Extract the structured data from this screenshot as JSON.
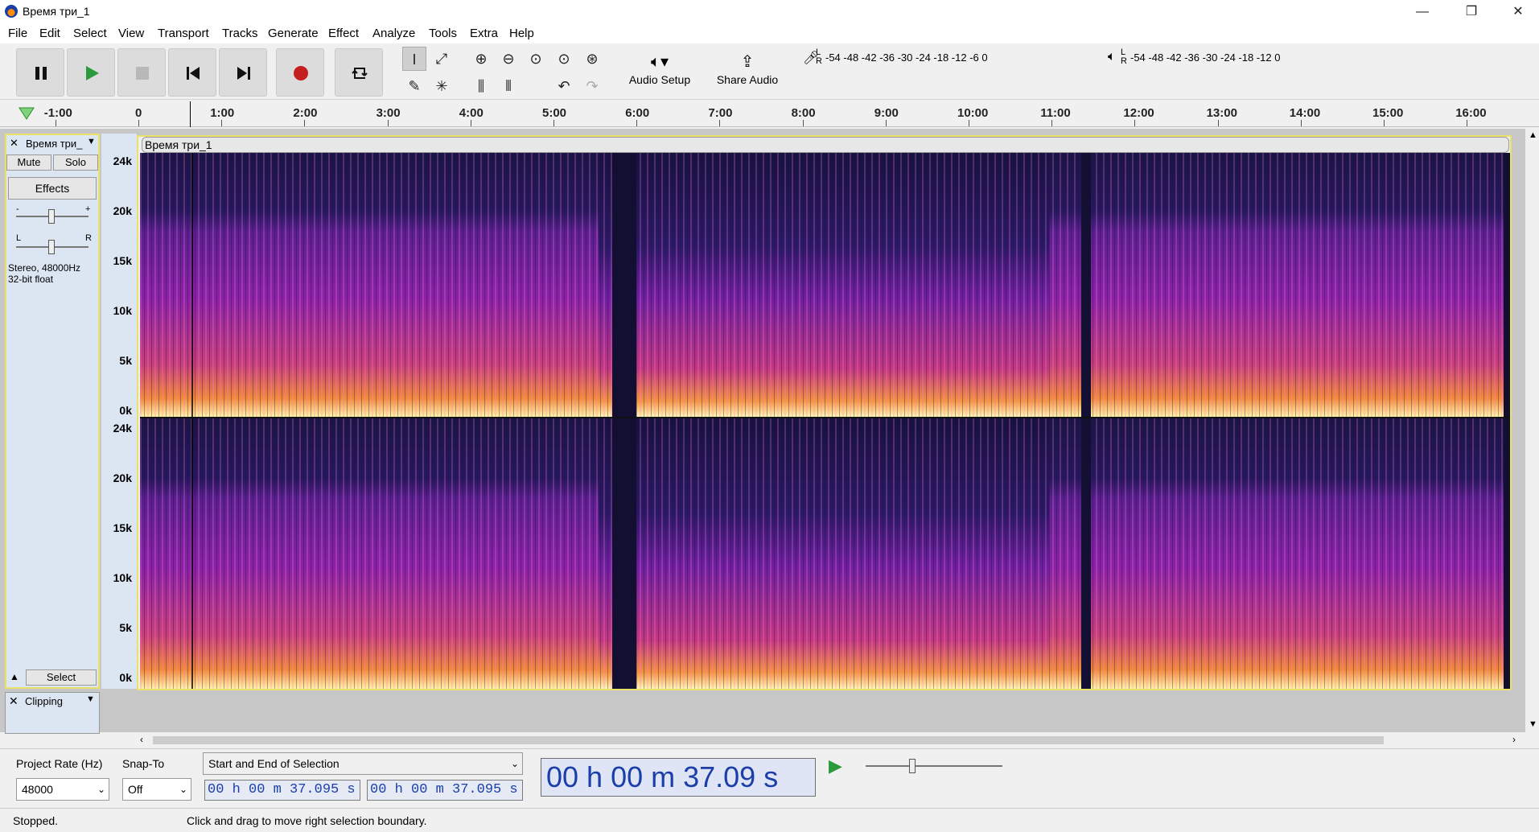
{
  "window": {
    "title": "Время три_1",
    "controls": [
      "—",
      "❐",
      "✕"
    ]
  },
  "menu": [
    "File",
    "Edit",
    "Select",
    "View",
    "Transport",
    "Tracks",
    "Generate",
    "Effect",
    "Analyze",
    "Tools",
    "Extra",
    "Help"
  ],
  "toolbar": {
    "audio_setup": "Audio Setup",
    "share_audio": "Share Audio",
    "record_meter": {
      "L": "L",
      "R": "R",
      "ticks": "-54  -48  -42  -36  -30  -24  -18  -12  -6   0"
    },
    "play_meter": {
      "L": "L",
      "R": "R",
      "ticks": "-54  -48  -42  -36  -30  -24  -18  -12   0"
    }
  },
  "ruler": {
    "ticks": [
      "-1:00",
      "0",
      "1:00",
      "2:00",
      "3:00",
      "4:00",
      "5:00",
      "6:00",
      "7:00",
      "8:00",
      "9:00",
      "10:00",
      "11:00",
      "12:00",
      "13:00",
      "14:00",
      "15:00",
      "16:00"
    ]
  },
  "track": {
    "name": "Время три_",
    "clip_name": "Время три_1",
    "mute": "Mute",
    "solo": "Solo",
    "effects": "Effects",
    "gain_minus": "-",
    "gain_plus": "+",
    "pan_left": "L",
    "pan_right": "R",
    "info_line1": "Stereo, 48000Hz",
    "info_line2": "32-bit float",
    "select": "Select",
    "freq_labels": [
      "24k",
      "20k",
      "15k",
      "10k",
      "5k",
      "0k"
    ]
  },
  "label_track": {
    "name": "Clipping"
  },
  "selection_toolbar": {
    "project_rate_label": "Project Rate (Hz)",
    "snap_to_label": "Snap-To",
    "project_rate_value": "48000",
    "snap_value": "Off",
    "selection_mode": "Start and End of Selection",
    "start_time": "00 h 00 m 37.095 s",
    "end_time": "00 h 00 m 37.095 s",
    "audio_position": "00 h 00 m 37.09 s"
  },
  "status": {
    "state": "Stopped.",
    "hint": "Click and drag to move right selection boundary."
  }
}
